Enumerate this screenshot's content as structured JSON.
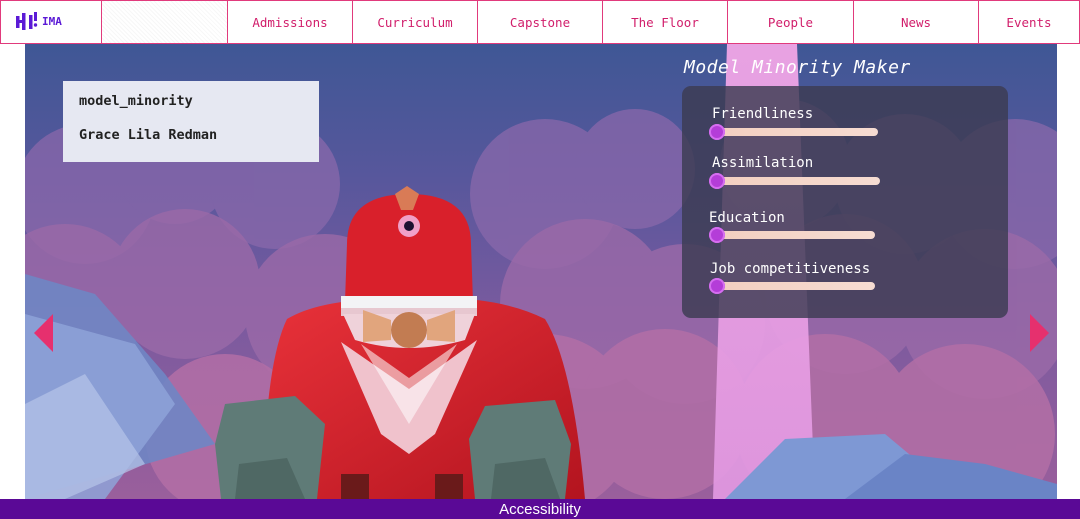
{
  "brand": {
    "logo_text": "IMA"
  },
  "nav": {
    "items": [
      {
        "label": "Admissions"
      },
      {
        "label": "Curriculum"
      },
      {
        "label": "Capstone"
      },
      {
        "label": "The Floor"
      },
      {
        "label": "People"
      },
      {
        "label": "News"
      },
      {
        "label": "Events"
      }
    ]
  },
  "project": {
    "title": "model_minority",
    "author": "Grace Lila Redman"
  },
  "maker": {
    "title": "Model Minority Maker",
    "sliders": [
      {
        "label": "Friendliness",
        "value": 0.0
      },
      {
        "label": "Assimilation",
        "value": 0.0
      },
      {
        "label": "Education",
        "value": 0.0
      },
      {
        "label": "Job competitiveness",
        "value": 0.0
      }
    ]
  },
  "footer": {
    "accessibility_label": "Accessibility"
  },
  "colors": {
    "accent": "#e13a7c",
    "nav_text": "#d11e6b",
    "logo": "#5b1ad6",
    "footer_bg": "#5a0996",
    "slider_thumb": "#b43dd8",
    "character_red": "#d9202b"
  },
  "icons": [
    "ima-logo-icon",
    "arrow-left-icon",
    "arrow-right-icon"
  ]
}
